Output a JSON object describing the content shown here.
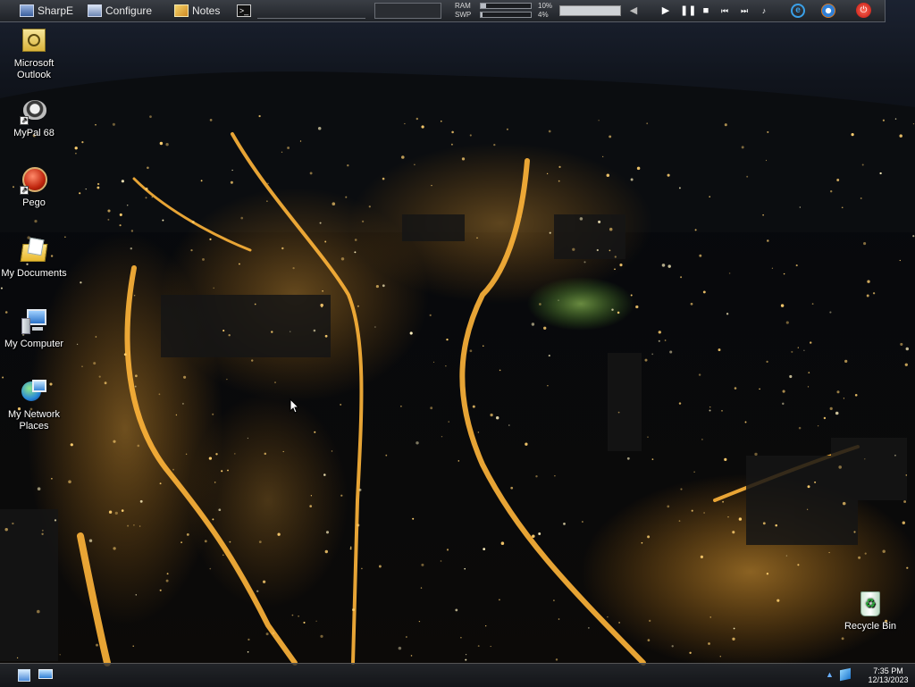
{
  "topbar": {
    "items": [
      {
        "label": "SharpE",
        "icon": "sharpe-icon"
      },
      {
        "label": "Configure",
        "icon": "configure-icon"
      },
      {
        "label": "Notes",
        "icon": "notes-icon"
      }
    ],
    "terminal_icon": "terminal-icon",
    "address_value": "",
    "search_value": "",
    "ram_label": "RAM",
    "ram_percent": "10%",
    "ram_fraction": 0.1,
    "swp_label": "SWP",
    "swp_percent": "4%",
    "swp_fraction": 0.04,
    "media_track_value": "",
    "controls": [
      "volume-icon",
      "play-icon",
      "pause-icon",
      "stop-icon",
      "previous-icon",
      "next-icon",
      "playlist-icon"
    ],
    "quick_launch": [
      "internet-explorer-icon",
      "media-player-icon",
      "shutdown-icon"
    ]
  },
  "desktop_icons": [
    {
      "label": "Microsoft Outlook",
      "icon": "outlook-icon"
    },
    {
      "label": "MyPal 68",
      "icon": "mypal-icon"
    },
    {
      "label": "Pego",
      "icon": "pego-icon"
    },
    {
      "label": "My Documents",
      "icon": "my-documents-icon"
    },
    {
      "label": "My Computer",
      "icon": "my-computer-icon"
    },
    {
      "label": "My Network Places",
      "icon": "network-places-icon"
    },
    {
      "label": "Recycle Bin",
      "icon": "recycle-bin-icon"
    }
  ],
  "taskbar": {
    "time": "7:35 PM",
    "date": "12/13/2023"
  },
  "colors": {
    "topbar": "#2b2e33",
    "city_light": "#ffa31a"
  }
}
